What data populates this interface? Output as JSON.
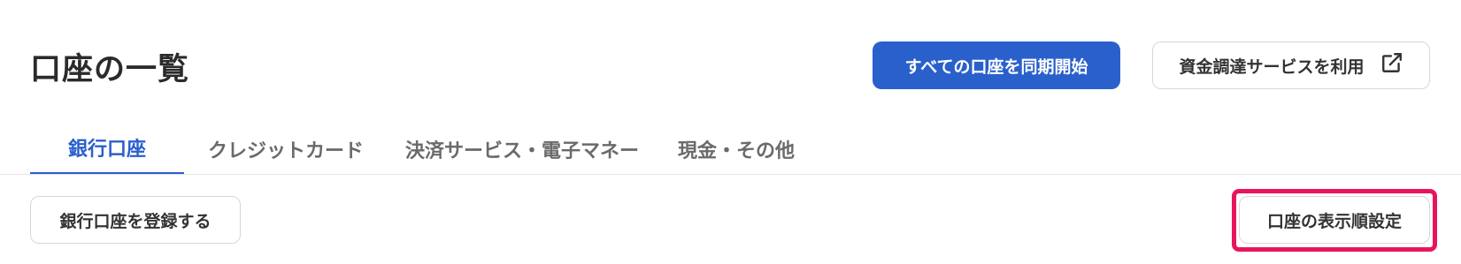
{
  "header": {
    "title": "口座の一覧",
    "sync_all_label": "すべての口座を同期開始",
    "funding_label": "資金調達サービスを利用"
  },
  "tabs": [
    {
      "label": "銀行口座",
      "active": true
    },
    {
      "label": "クレジットカード",
      "active": false
    },
    {
      "label": "決済サービス・電子マネー",
      "active": false
    },
    {
      "label": "現金・その他",
      "active": false
    }
  ],
  "actions": {
    "register_label": "銀行口座を登録する",
    "display_order_label": "口座の表示順設定"
  },
  "colors": {
    "primary": "#2a60cc",
    "highlight": "#e8155e",
    "tab_inactive": "#6a6a6a"
  },
  "icons": {
    "funding": "external-link-icon"
  }
}
